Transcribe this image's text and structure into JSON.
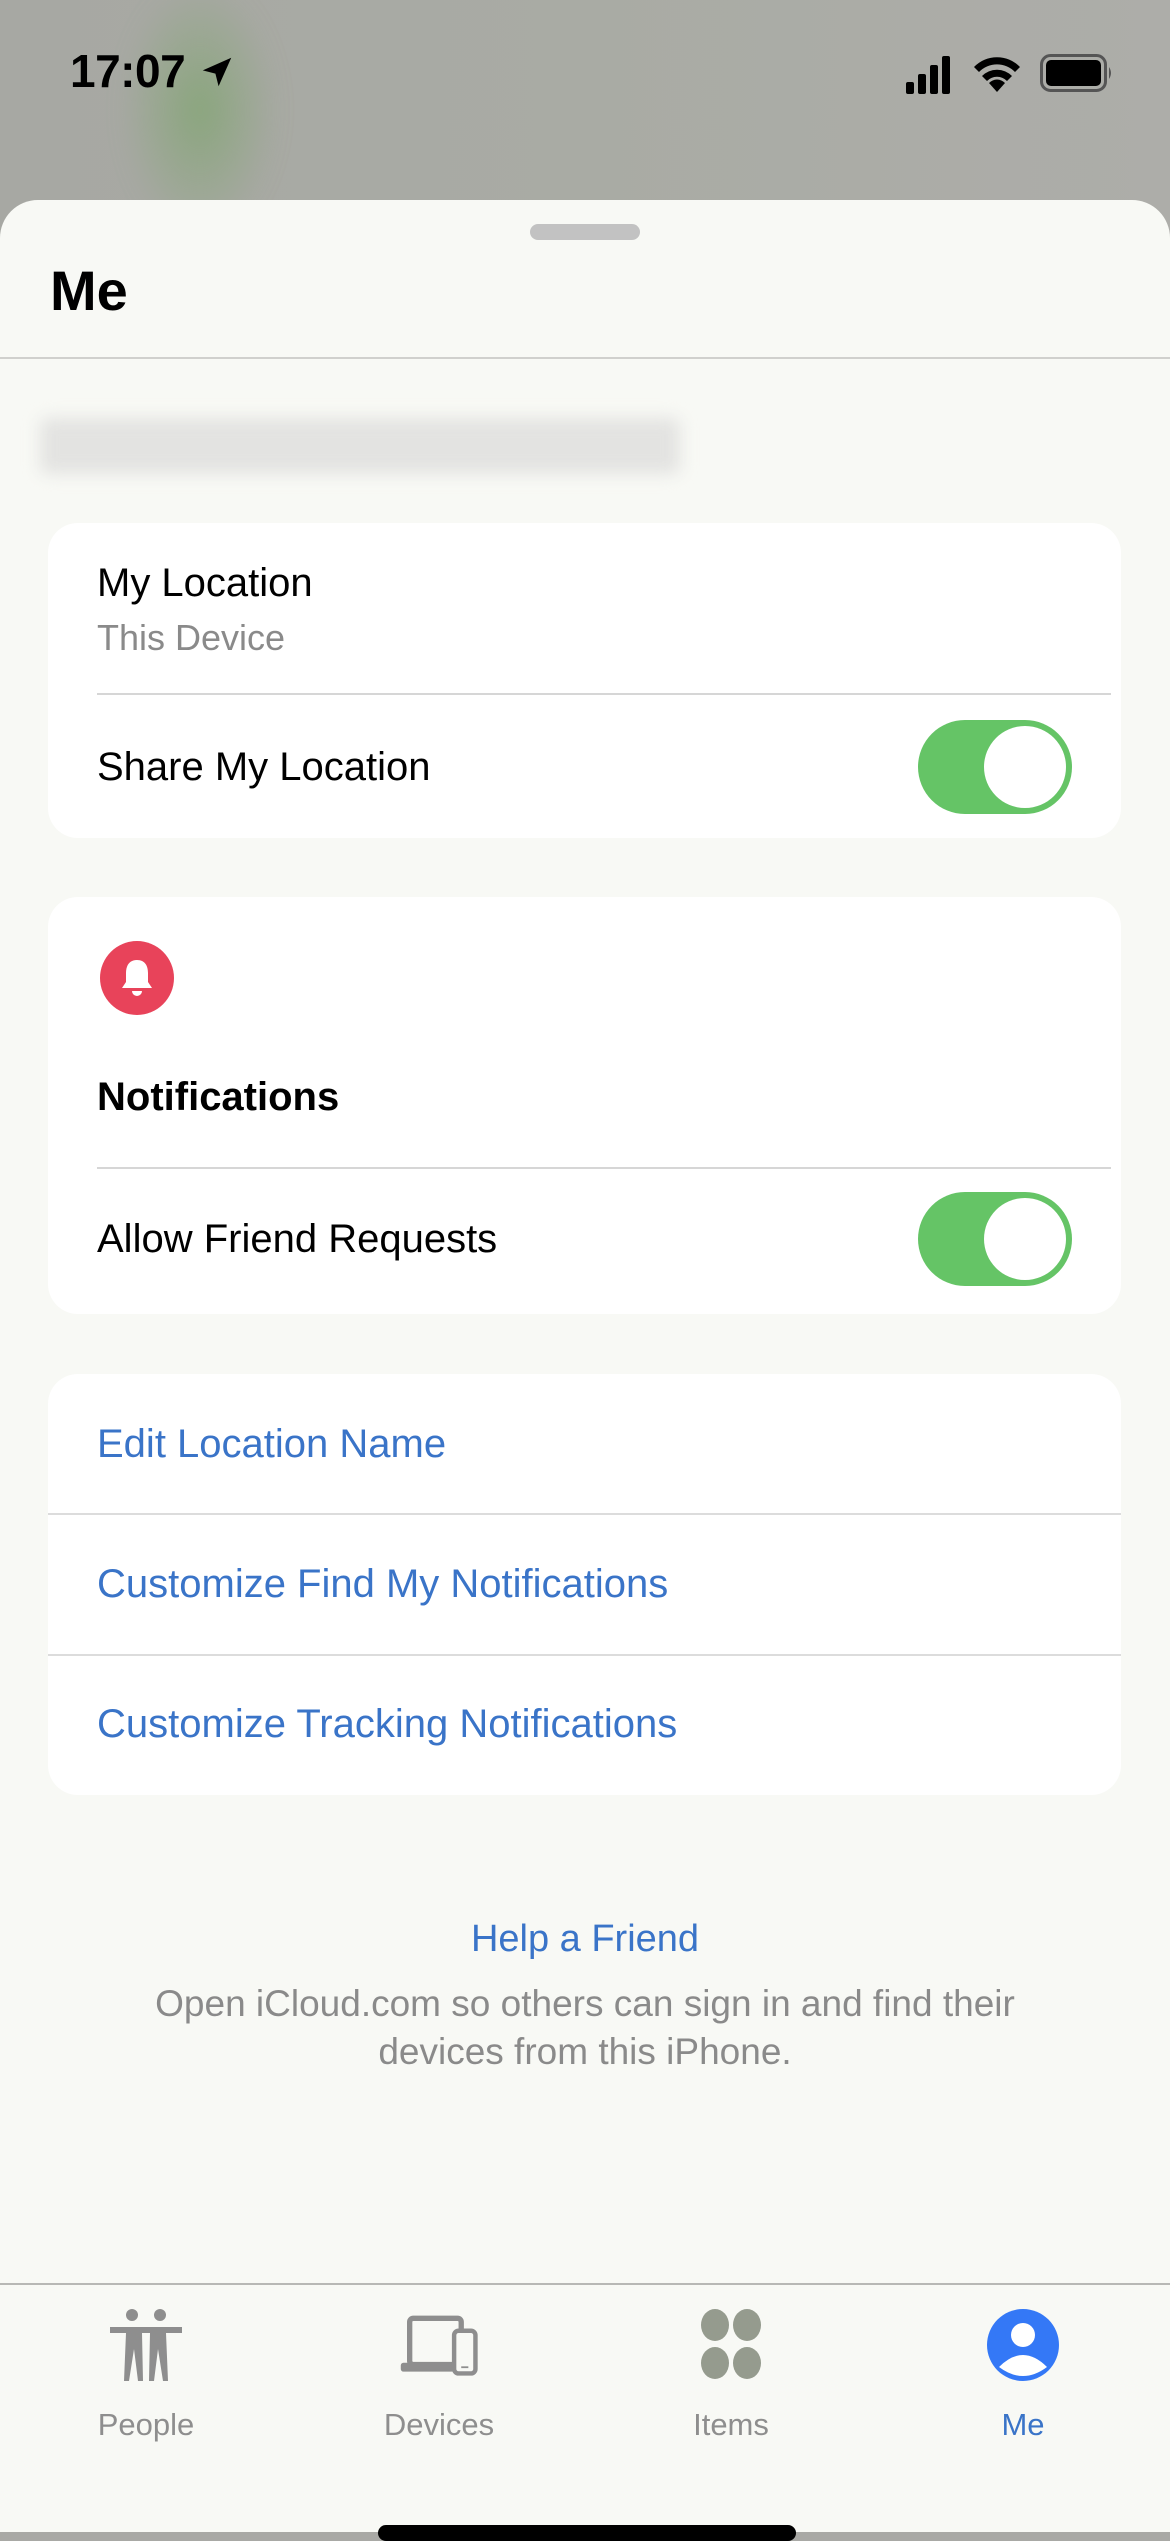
{
  "status_bar": {
    "time": "17:07",
    "location_icon": "location-arrow-icon",
    "signal_icon": "cellular-signal-icon",
    "wifi_icon": "wifi-icon",
    "battery_icon": "battery-full-icon"
  },
  "sheet": {
    "title": "Me"
  },
  "location_card": {
    "title": "My Location",
    "subtitle": "This Device",
    "share_label": "Share My Location",
    "share_enabled": true
  },
  "notifications_card": {
    "icon": "bell-icon",
    "icon_color": "#e8435a",
    "title": "Notifications",
    "friend_requests_label": "Allow Friend Requests",
    "friend_requests_enabled": true
  },
  "actions": [
    {
      "label": "Edit Location Name"
    },
    {
      "label": "Customize Find My Notifications"
    },
    {
      "label": "Customize Tracking Notifications"
    }
  ],
  "help": {
    "link": "Help a Friend",
    "description": "Open iCloud.com so others can sign in and find their devices from this iPhone."
  },
  "tabs": [
    {
      "label": "People",
      "icon": "people-icon",
      "active": false
    },
    {
      "label": "Devices",
      "icon": "devices-icon",
      "active": false
    },
    {
      "label": "Items",
      "icon": "items-icon",
      "active": false
    },
    {
      "label": "Me",
      "icon": "person-circle-icon",
      "active": true
    }
  ],
  "colors": {
    "accent": "#3a74c8",
    "toggle_on": "#65c466",
    "inactive_tab": "#8e8e8e"
  }
}
